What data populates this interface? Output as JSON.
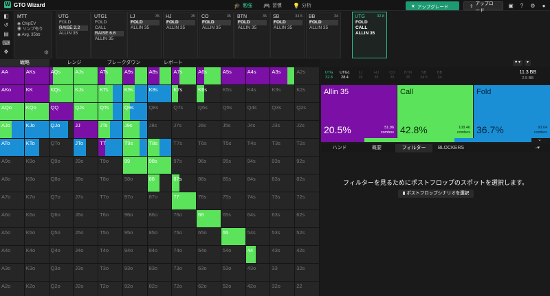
{
  "app": {
    "logo_mark": "W",
    "name": "GTO Wizard"
  },
  "nav": {
    "tabs": [
      {
        "label": "勉強",
        "icon": "graduation-cap-icon",
        "glyph": "🎓",
        "active": true
      },
      {
        "label": "習慣",
        "icon": "gamepad-icon",
        "glyph": "🎮",
        "active": false
      },
      {
        "label": "分析",
        "icon": "lightbulb-icon",
        "glyph": "💡",
        "active": false
      }
    ],
    "upgrade_label": "アップグレード",
    "upload_label": "アップロード"
  },
  "colors": {
    "allin": "#7b0fa6",
    "call": "#5be35b",
    "fold": "#1a8fd6",
    "accent": "#2fb68a"
  },
  "game": {
    "title": "MTT",
    "lines": [
      "ChipEV",
      "リンプ有り",
      "Avg. 35bb"
    ]
  },
  "positions": [
    {
      "name": "UTG",
      "stack": "",
      "actions": [
        {
          "t": "FOLD"
        },
        {
          "t": "RAISE 2.2",
          "sel": true
        },
        {
          "t": "ALLIN 35"
        }
      ]
    },
    {
      "name": "UTG1",
      "stack": "",
      "actions": [
        {
          "t": "FOLD"
        },
        {
          "t": "CALL"
        },
        {
          "t": "RAISE 6.6",
          "sel": true
        },
        {
          "t": "ALLIN 35"
        }
      ]
    },
    {
      "name": "LJ",
      "stack": "35",
      "actions": [
        {
          "t": "FOLD",
          "sel": true,
          "bold": true
        },
        {
          "t": "ALLIN 35"
        }
      ]
    },
    {
      "name": "HJ",
      "stack": "35",
      "actions": [
        {
          "t": "FOLD",
          "sel": true,
          "bold": true
        },
        {
          "t": "ALLIN 35"
        }
      ]
    },
    {
      "name": "CO",
      "stack": "35",
      "actions": [
        {
          "t": "FOLD",
          "sel": true,
          "bold": true
        },
        {
          "t": "ALLIN 35"
        }
      ]
    },
    {
      "name": "BTN",
      "stack": "35",
      "actions": [
        {
          "t": "FOLD",
          "sel": true,
          "bold": true
        },
        {
          "t": "ALLIN 35"
        }
      ]
    },
    {
      "name": "SB",
      "stack": "34.5",
      "actions": [
        {
          "t": "FOLD",
          "sel": true,
          "bold": true
        },
        {
          "t": "ALLIN 35"
        }
      ]
    },
    {
      "name": "BB",
      "stack": "34",
      "actions": [
        {
          "t": "FOLD",
          "sel": true,
          "bold": true
        },
        {
          "t": "ALLIN 35"
        }
      ]
    },
    {
      "name": "UTG",
      "stack": "32.8",
      "active": true,
      "actions": [
        {
          "t": "FOLD",
          "bold": true
        },
        {
          "t": "CALL",
          "bold": true
        },
        {
          "t": "ALLIN 35",
          "bold": true
        }
      ]
    }
  ],
  "subtabs": [
    "戦略",
    "レンジ",
    "ブレークダウン",
    "レポート"
  ],
  "grid": {
    "ranks": [
      "A",
      "K",
      "Q",
      "J",
      "T",
      "9",
      "8",
      "7",
      "6",
      "5",
      "4",
      "3",
      "2"
    ],
    "strategies": {
      "AA": [
        1,
        0,
        0
      ],
      "AKs": [
        1,
        0,
        0
      ],
      "AQs": [
        0.15,
        0.85,
        0
      ],
      "AJs": [
        0,
        1,
        0
      ],
      "ATs": [
        0.3,
        0.7,
        0
      ],
      "A9s": [
        0.5,
        0.5,
        0
      ],
      "A8s": [
        0.5,
        0.5,
        0
      ],
      "A7s": [
        0.3,
        0.7,
        0
      ],
      "A6s": [
        0.3,
        0.7,
        0
      ],
      "A5s": [
        1,
        0,
        0
      ],
      "A4s": [
        1,
        0,
        0
      ],
      "A3s": [
        0.7,
        0.3,
        0
      ],
      "A2s": [
        0,
        0,
        0
      ],
      "AKo": [
        1,
        0,
        0
      ],
      "KK": [
        1,
        0,
        0
      ],
      "KQs": [
        0,
        1,
        0
      ],
      "KJs": [
        0,
        1,
        0
      ],
      "KTs": [
        0,
        0.6,
        0.4
      ],
      "K9s": [
        0,
        0.5,
        0.5
      ],
      "K8s": [
        0,
        0,
        1
      ],
      "K7s": [
        0,
        0.25,
        0
      ],
      "K6s": [
        0,
        0.3,
        0
      ],
      "AQo": [
        0,
        1,
        0
      ],
      "KQo": [
        0,
        1,
        0
      ],
      "QQ": [
        1,
        0,
        0
      ],
      "QJs": [
        0,
        1,
        0
      ],
      "QTs": [
        0,
        0.6,
        0.4
      ],
      "Q9s": [
        0,
        0.3,
        0.7
      ],
      "AJo": [
        0,
        0.5,
        0.5
      ],
      "KJo": [
        0,
        0,
        1
      ],
      "QJo": [
        0,
        0,
        0.8
      ],
      "JJ": [
        1,
        0,
        0
      ],
      "JTs": [
        0,
        0.5,
        0.5
      ],
      "J9s": [
        0,
        0.7,
        0.3
      ],
      "ATo": [
        0,
        0,
        1
      ],
      "KTo": [
        0,
        0,
        0.6
      ],
      "JTo": [
        0,
        0,
        0.5
      ],
      "TT": [
        0.3,
        0,
        0.7
      ],
      "T9s": [
        0,
        0.7,
        0.3
      ],
      "T8s": [
        0,
        0.5,
        0.5
      ],
      "99": [
        0,
        1,
        0
      ],
      "98s": [
        0,
        1,
        0
      ],
      "88": [
        0,
        0.5,
        0
      ],
      "87s": [
        0,
        0.3,
        0
      ],
      "77": [
        0,
        1,
        0
      ],
      "66": [
        0,
        1,
        0
      ],
      "55": [
        0,
        1,
        0
      ],
      "44": [
        0,
        0.4,
        0
      ]
    }
  },
  "right": {
    "positions": [
      {
        "n": "UTG",
        "v": "32.8",
        "c": "g"
      },
      {
        "n": "UTG1",
        "v": "28.4",
        "c": "w"
      },
      {
        "n": "LJ",
        "v": "35",
        "c": ""
      },
      {
        "n": "HJ",
        "v": "35",
        "c": ""
      },
      {
        "n": "CO",
        "v": "35",
        "c": ""
      },
      {
        "n": "BTN",
        "v": "35",
        "c": ""
      },
      {
        "n": "SB",
        "v": "34.5",
        "c": ""
      },
      {
        "n": "BB",
        "v": "34",
        "c": ""
      }
    ],
    "pot": "11.3 BB",
    "pot_sub": "2.5 BB",
    "actions": [
      {
        "name": "Allin 35",
        "pct": "20.5%",
        "combos": "51.96",
        "combos_label": "combos"
      },
      {
        "name": "Call",
        "pct": "42.8%",
        "combos": "108.46",
        "combos_label": "combos"
      },
      {
        "name": "Fold",
        "pct": "36.7%",
        "combos": "93.04",
        "combos_label": "combos"
      }
    ],
    "mix": {
      "allin": 0.205,
      "call": 0.428,
      "fold": 0.367
    },
    "tabs": [
      "ハンド",
      "概要",
      "フィルター",
      "BLOCKERS"
    ],
    "filter_message": "フィルターを見るためにポストフロップのスポットを選択します。",
    "filter_button": "ポストフロップシナリオを選択"
  }
}
